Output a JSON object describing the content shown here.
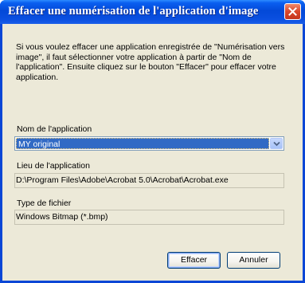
{
  "window": {
    "title": "Effacer une numérisation de l'application d'image"
  },
  "description": "Si vous voulez effacer une application enregistrée de \"Numérisation vers image\", il faut sélectionner votre application à partir de \"Nom de l'application\". Ensuite cliquez sur le bouton \"Effacer\" pour effacer votre application.",
  "app_name": {
    "label": "Nom de l'application",
    "selected": "MY original"
  },
  "app_location": {
    "label": "Lieu de l'application",
    "value": "D:\\Program Files\\Adobe\\Acrobat 5.0\\Acrobat\\Acrobat.exe"
  },
  "file_type": {
    "label": "Type de fichier",
    "value": "Windows Bitmap (*.bmp)"
  },
  "buttons": {
    "delete": "Effacer",
    "cancel": "Annuler"
  },
  "colors": {
    "titlebar": "#0349d8",
    "dialog_bg": "#ece9d8",
    "selection": "#316ac5",
    "close_button": "#d9472b"
  }
}
